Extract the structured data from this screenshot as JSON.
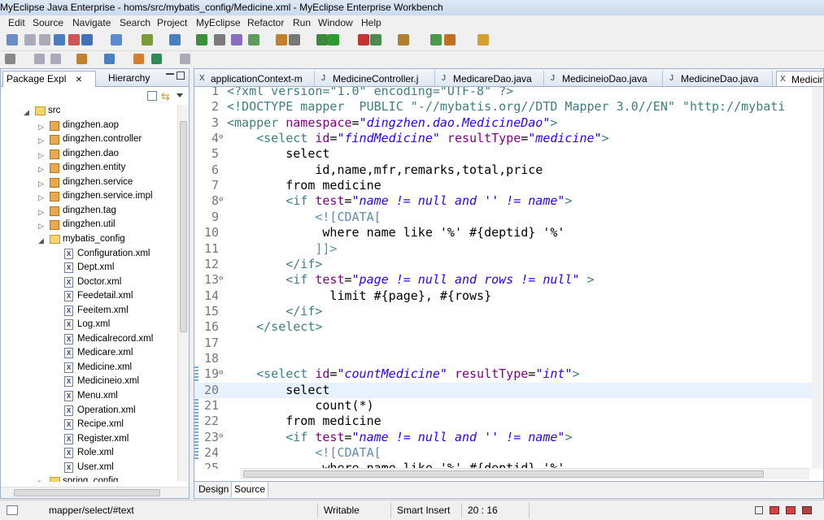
{
  "window": {
    "title": "MyEclipse Java Enterprise - homs/src/mybatis_config/Medicine.xml - MyEclipse Enterprise Workbench"
  },
  "menu": [
    "Edit",
    "Source",
    "Navigate",
    "Search",
    "Project",
    "MyEclipse",
    "Refactor",
    "Run",
    "Window",
    "Help"
  ],
  "left_panel": {
    "tabs": [
      {
        "label": "Package Expl",
        "active": true
      },
      {
        "label": "Hierarchy",
        "active": false
      }
    ],
    "tree": [
      {
        "label": "src",
        "type": "folder",
        "indent": 1,
        "expanded": true
      },
      {
        "label": "dingzhen.aop",
        "type": "package",
        "indent": 2
      },
      {
        "label": "dingzhen.controller",
        "type": "package",
        "indent": 2
      },
      {
        "label": "dingzhen.dao",
        "type": "package",
        "indent": 2
      },
      {
        "label": "dingzhen.entity",
        "type": "package",
        "indent": 2
      },
      {
        "label": "dingzhen.service",
        "type": "package",
        "indent": 2
      },
      {
        "label": "dingzhen.service.impl",
        "type": "package",
        "indent": 2
      },
      {
        "label": "dingzhen.tag",
        "type": "package",
        "indent": 2
      },
      {
        "label": "dingzhen.util",
        "type": "package",
        "indent": 2
      },
      {
        "label": "mybatis_config",
        "type": "folder",
        "indent": 2,
        "expanded": true
      },
      {
        "label": "Configuration.xml",
        "type": "xml",
        "indent": 3
      },
      {
        "label": "Dept.xml",
        "type": "xml",
        "indent": 3
      },
      {
        "label": "Doctor.xml",
        "type": "xml",
        "indent": 3
      },
      {
        "label": "Feedetail.xml",
        "type": "xml",
        "indent": 3
      },
      {
        "label": "Feeitem.xml",
        "type": "xml",
        "indent": 3
      },
      {
        "label": "Log.xml",
        "type": "xml",
        "indent": 3
      },
      {
        "label": "Medicalrecord.xml",
        "type": "xml",
        "indent": 3
      },
      {
        "label": "Medicare.xml",
        "type": "xml",
        "indent": 3
      },
      {
        "label": "Medicine.xml",
        "type": "xml",
        "indent": 3
      },
      {
        "label": "Medicineio.xml",
        "type": "xml",
        "indent": 3
      },
      {
        "label": "Menu.xml",
        "type": "xml",
        "indent": 3
      },
      {
        "label": "Operation.xml",
        "type": "xml",
        "indent": 3
      },
      {
        "label": "Recipe.xml",
        "type": "xml",
        "indent": 3
      },
      {
        "label": "Register.xml",
        "type": "xml",
        "indent": 3
      },
      {
        "label": "Role.xml",
        "type": "xml",
        "indent": 3
      },
      {
        "label": "User.xml",
        "type": "xml",
        "indent": 3
      },
      {
        "label": "spring_config",
        "type": "folder",
        "indent": 2
      }
    ]
  },
  "editor": {
    "tabs": [
      {
        "label": "applicationContext-m",
        "active": false
      },
      {
        "label": "MedicineController.j",
        "active": false
      },
      {
        "label": "MedicareDao.java",
        "active": false
      },
      {
        "label": "MedicineioDao.java",
        "active": false
      },
      {
        "label": "MedicineDao.java",
        "active": false
      },
      {
        "label": "Medicin",
        "active": true
      }
    ],
    "current_line": 20,
    "lines": [
      {
        "n": "1",
        "fold": "",
        "parts": [
          {
            "t": "<?xml version=\"1.0\" encoding=\"UTF-8\" ?>",
            "c": "c-tag"
          }
        ]
      },
      {
        "n": "2",
        "fold": "",
        "parts": [
          {
            "t": "<!DOCTYPE mapper  PUBLIC \"-//mybatis.org//DTD Mapper 3.0//EN\" \"http://mybati",
            "c": "c-doctype"
          }
        ]
      },
      {
        "n": "3",
        "fold": "",
        "parts": [
          {
            "t": "<mapper ",
            "c": "c-tag"
          },
          {
            "t": "namespace",
            "c": "c-attr"
          },
          {
            "t": "=",
            "c": "c-text"
          },
          {
            "t": "\"dingzhen.dao.MedicineDao\"",
            "c": "c-str"
          },
          {
            "t": ">",
            "c": "c-tag"
          }
        ]
      },
      {
        "n": "4",
        "fold": "⊖",
        "parts": [
          {
            "t": "    <select ",
            "c": "c-tag"
          },
          {
            "t": "id",
            "c": "c-attr"
          },
          {
            "t": "=",
            "c": "c-text"
          },
          {
            "t": "\"findMedicine\"",
            "c": "c-str"
          },
          {
            "t": " resultType",
            "c": "c-attr"
          },
          {
            "t": "=",
            "c": "c-text"
          },
          {
            "t": "\"medicine\"",
            "c": "c-str"
          },
          {
            "t": ">",
            "c": "c-tag"
          }
        ]
      },
      {
        "n": "5",
        "fold": "",
        "parts": [
          {
            "t": "        select",
            "c": "c-text"
          }
        ]
      },
      {
        "n": "6",
        "fold": "",
        "parts": [
          {
            "t": "            id,name,mfr,remarks,total,price",
            "c": "c-text"
          }
        ]
      },
      {
        "n": "7",
        "fold": "",
        "parts": [
          {
            "t": "        from medicine",
            "c": "c-text"
          }
        ]
      },
      {
        "n": "8",
        "fold": "⊖",
        "parts": [
          {
            "t": "        <if ",
            "c": "c-tag"
          },
          {
            "t": "test",
            "c": "c-attr"
          },
          {
            "t": "=",
            "c": "c-text"
          },
          {
            "t": "\"name != null and '' != name\"",
            "c": "c-str"
          },
          {
            "t": ">",
            "c": "c-tag"
          }
        ]
      },
      {
        "n": "9",
        "fold": "",
        "parts": [
          {
            "t": "            <![CDATA[",
            "c": "c-cdata"
          }
        ]
      },
      {
        "n": "10",
        "fold": "",
        "parts": [
          {
            "t": "             where name like '%' #{deptid} '%'",
            "c": "c-text"
          }
        ]
      },
      {
        "n": "11",
        "fold": "",
        "parts": [
          {
            "t": "            ]]>",
            "c": "c-cdata"
          }
        ]
      },
      {
        "n": "12",
        "fold": "",
        "parts": [
          {
            "t": "        </if>",
            "c": "c-tag"
          }
        ]
      },
      {
        "n": "13",
        "fold": "⊖",
        "parts": [
          {
            "t": "        <if ",
            "c": "c-tag"
          },
          {
            "t": "test",
            "c": "c-attr"
          },
          {
            "t": "=",
            "c": "c-text"
          },
          {
            "t": "\"page != null and rows != null\"",
            "c": "c-str"
          },
          {
            "t": " >",
            "c": "c-tag"
          }
        ]
      },
      {
        "n": "14",
        "fold": "",
        "parts": [
          {
            "t": "              limit #{page}, #{rows}",
            "c": "c-text"
          }
        ]
      },
      {
        "n": "15",
        "fold": "",
        "parts": [
          {
            "t": "        </if>",
            "c": "c-tag"
          }
        ]
      },
      {
        "n": "16",
        "fold": "",
        "parts": [
          {
            "t": "    </select>",
            "c": "c-tag"
          }
        ]
      },
      {
        "n": "17",
        "fold": "",
        "parts": []
      },
      {
        "n": "18",
        "fold": "",
        "parts": []
      },
      {
        "n": "19",
        "fold": "⊖",
        "parts": [
          {
            "t": "    <select ",
            "c": "c-tag"
          },
          {
            "t": "id",
            "c": "c-attr"
          },
          {
            "t": "=",
            "c": "c-text"
          },
          {
            "t": "\"countMedicine\"",
            "c": "c-str"
          },
          {
            "t": " resultType",
            "c": "c-attr"
          },
          {
            "t": "=",
            "c": "c-text"
          },
          {
            "t": "\"int\"",
            "c": "c-str"
          },
          {
            "t": ">",
            "c": "c-tag"
          }
        ]
      },
      {
        "n": "20",
        "fold": "",
        "parts": [
          {
            "t": "        select",
            "c": "c-text"
          }
        ]
      },
      {
        "n": "21",
        "fold": "",
        "parts": [
          {
            "t": "            count(*)",
            "c": "c-text"
          }
        ]
      },
      {
        "n": "22",
        "fold": "",
        "parts": [
          {
            "t": "        from medicine",
            "c": "c-text"
          }
        ]
      },
      {
        "n": "23",
        "fold": "⊖",
        "parts": [
          {
            "t": "        <if ",
            "c": "c-tag"
          },
          {
            "t": "test",
            "c": "c-attr"
          },
          {
            "t": "=",
            "c": "c-text"
          },
          {
            "t": "\"name != null and '' != name\"",
            "c": "c-str"
          },
          {
            "t": ">",
            "c": "c-tag"
          }
        ]
      },
      {
        "n": "24",
        "fold": "",
        "parts": [
          {
            "t": "            <![CDATA[",
            "c": "c-cdata"
          }
        ]
      },
      {
        "n": "25",
        "fold": "",
        "parts": [
          {
            "t": "             where name like '%' #{deptid} '%'",
            "c": "c-text"
          }
        ]
      }
    ],
    "bottom_tabs": [
      {
        "label": "Design",
        "active": false
      },
      {
        "label": "Source",
        "active": true
      }
    ]
  },
  "statusbar": {
    "path": "mapper/select/#text",
    "mode": "Writable",
    "insert": "Smart Insert",
    "position": "20 : 16"
  },
  "colors": {
    "tag": "#3f7f7f",
    "attr": "#7f007f",
    "string": "#2a00ff",
    "current_line": "#e8f2fe"
  }
}
